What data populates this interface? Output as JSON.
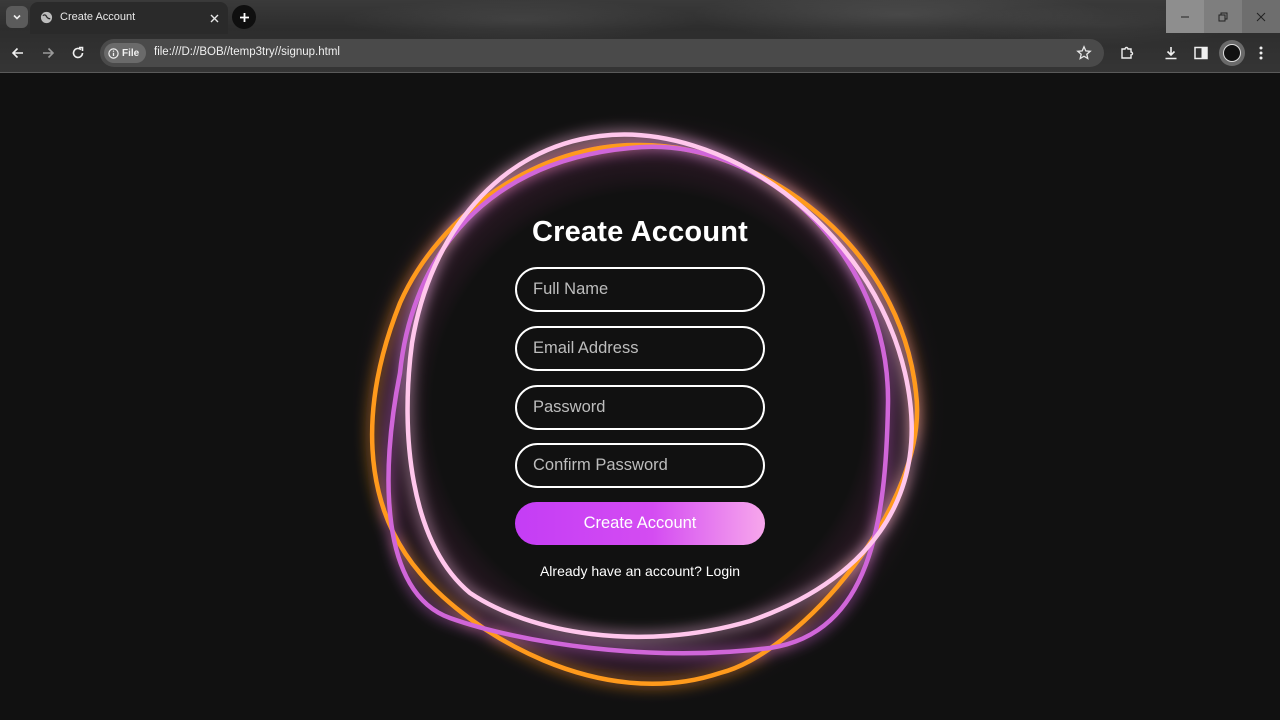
{
  "browser": {
    "tab_title": "Create Account",
    "url_chip": "File",
    "url": "file:///D://BOB//temp3try//signup.html"
  },
  "form": {
    "title": "Create Account",
    "full_name_placeholder": "Full Name",
    "email_placeholder": "Email Address",
    "password_placeholder": "Password",
    "confirm_placeholder": "Confirm Password",
    "submit_label": "Create Account",
    "login_prompt": "Already have an account?",
    "login_link": "Login"
  },
  "colors": {
    "background": "#111111",
    "ring_pink": "#ffc7ec",
    "ring_magenta": "#d066d9",
    "ring_orange": "#ff9a1c",
    "button_start": "#c43df5",
    "button_end": "#f7a7ec"
  }
}
